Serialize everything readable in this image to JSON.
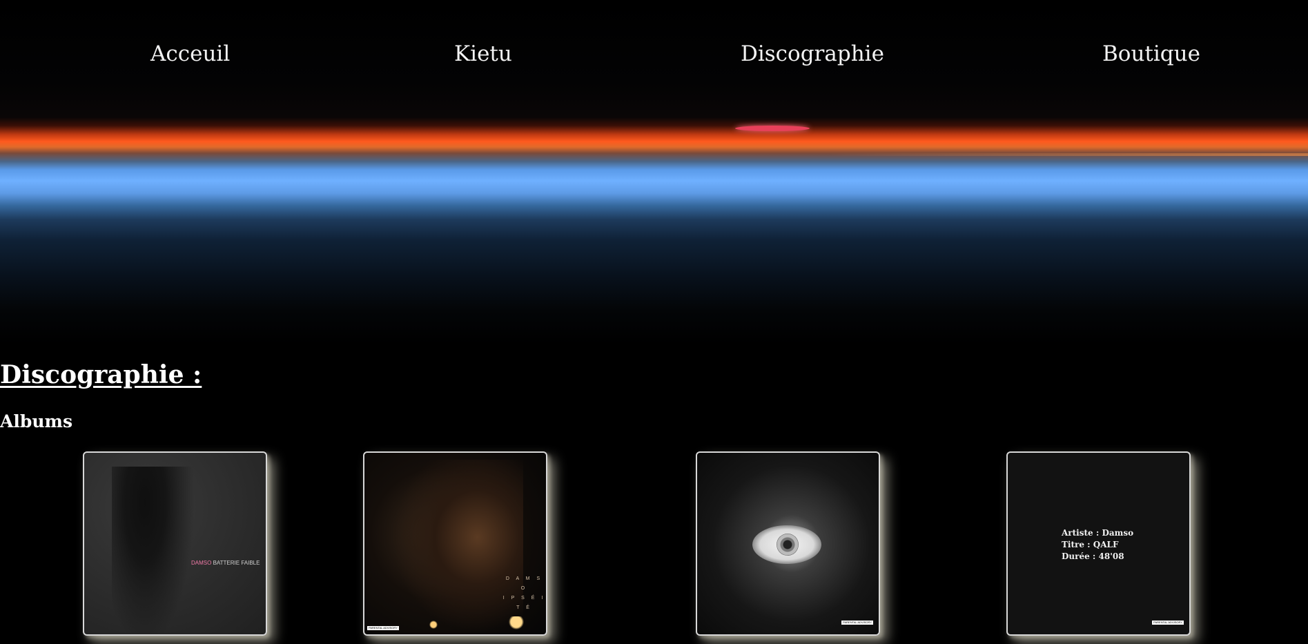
{
  "nav": {
    "items": [
      "Acceuil",
      "Kietu",
      "Discographie",
      "Boutique"
    ]
  },
  "section": {
    "title": "Discographie :",
    "subtitle": "Albums"
  },
  "albums": [
    {
      "artist": "DAMSO",
      "title": "BATTERIE FAIBLE"
    },
    {
      "artist": "D A M S O",
      "title": "I P S É I T É",
      "advisory": "PARENTAL ADVISORY"
    },
    {
      "advisory": "PARENTAL ADVISORY"
    },
    {
      "advisory": "PARENTAL ADVISORY",
      "info": [
        "Artiste : Damso",
        "Titre : QALF",
        "Durée : 48'08"
      ]
    }
  ],
  "colors": {
    "background": "#000000",
    "text": "#ffffff",
    "accent_orange": "#ff5a1e",
    "accent_blue": "#6fb0ff"
  }
}
